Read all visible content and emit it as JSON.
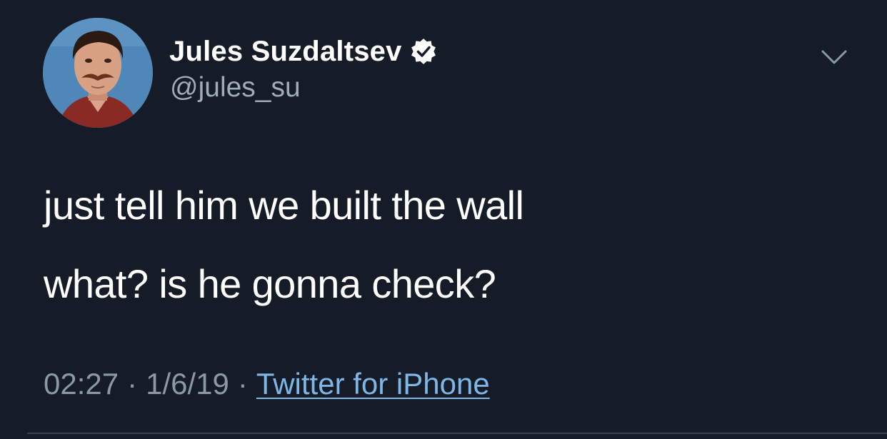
{
  "tweet": {
    "author": {
      "display_name": "Jules Suzdaltsev",
      "handle": "@jules_su",
      "verified": true,
      "avatar_icon": "profile-photo"
    },
    "text_lines": [
      "just tell him we built the wall",
      "what? is he gonna check?"
    ],
    "meta": {
      "time": "02:27",
      "separator": "·",
      "date": "1/6/19",
      "source": "Twitter for iPhone"
    },
    "menu_icon": "chevron-down-icon"
  },
  "colors": {
    "background": "#151c27",
    "text_primary": "#ffffff",
    "text_secondary": "#8b98a5",
    "link": "#7fb6e8",
    "divider": "#38444d"
  }
}
